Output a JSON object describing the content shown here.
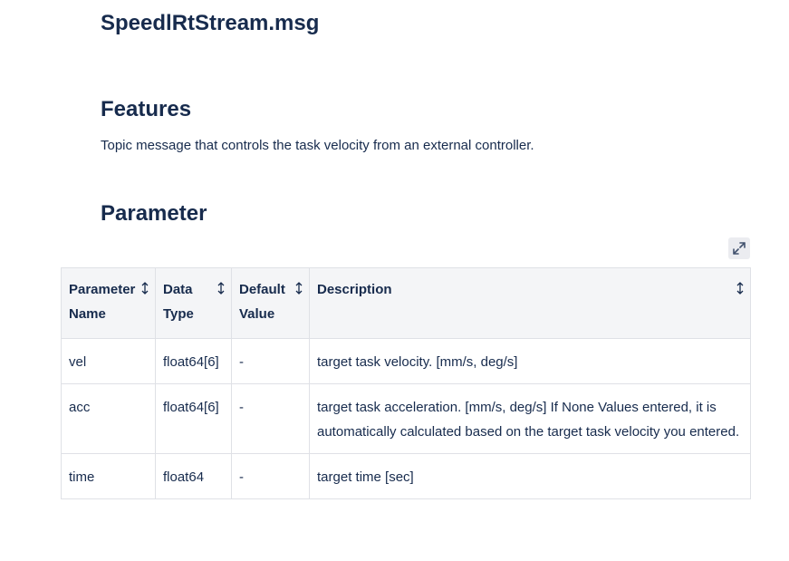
{
  "page": {
    "title": "SpeedlRtStream.msg",
    "features_heading": "Features",
    "features_description": "Topic message that controls the task velocity from an external controller.",
    "parameter_heading": "Parameter"
  },
  "table": {
    "columns": [
      {
        "label": "Parameter Name",
        "sort_icon": "sort-icon"
      },
      {
        "label": "Data Type",
        "sort_icon": "sort-icon"
      },
      {
        "label": "Default Value",
        "sort_icon": "sort-icon"
      },
      {
        "label": "Description",
        "sort_icon": "sort-icon"
      }
    ],
    "rows": [
      [
        "vel",
        "float64[6]",
        "-",
        "target task velocity. [mm/s, deg/s]"
      ],
      [
        "acc",
        "float64[6]",
        "-",
        "target task acceleration. [mm/s, deg/s] If None Values entered, it is automatically calculated based on the target task velocity you entered."
      ],
      [
        "time",
        "float64",
        "-",
        "target time [sec]"
      ]
    ]
  },
  "controls": {
    "expand_icon": "expand-icon"
  },
  "colors": {
    "text": "#172b4d",
    "header_bg": "#f4f5f7",
    "border": "#dfe1e6",
    "button_bg": "#ebecf0"
  }
}
